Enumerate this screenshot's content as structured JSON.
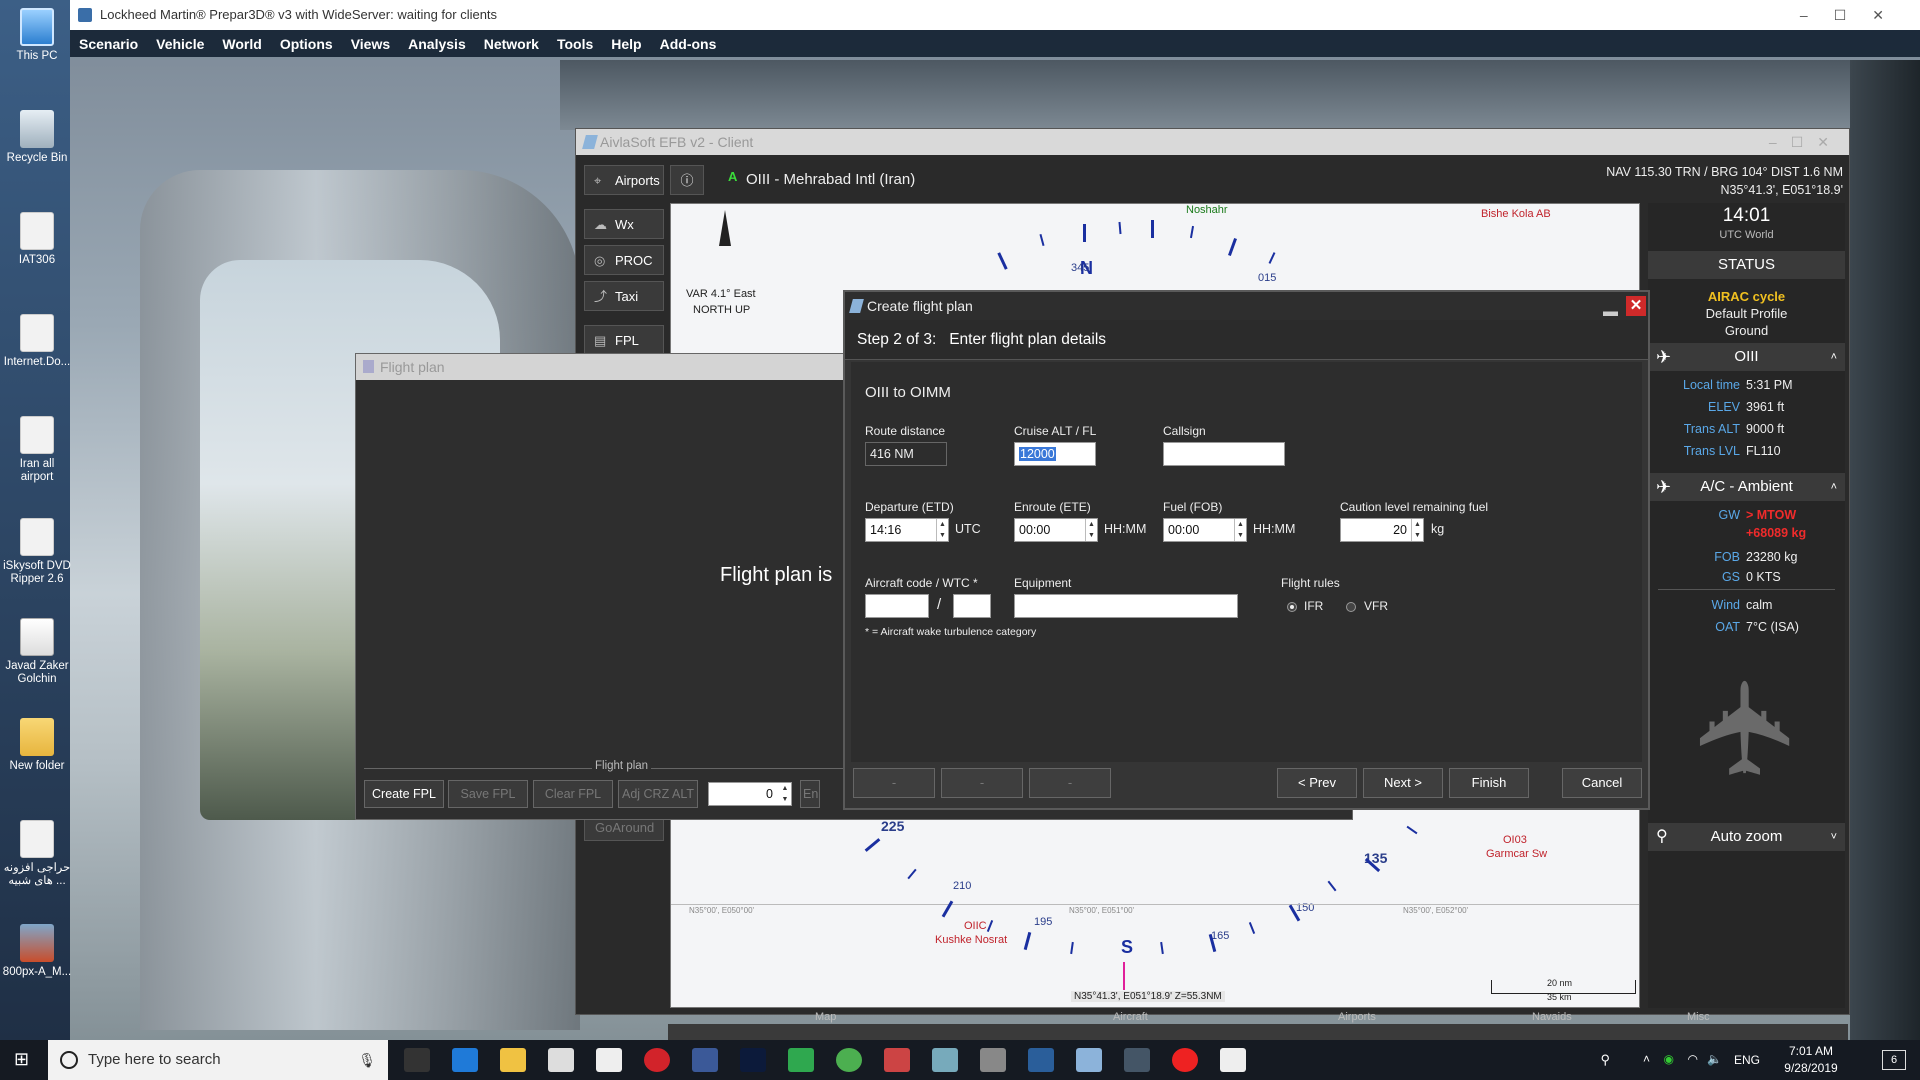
{
  "desktop": {
    "icons": [
      "This PC",
      "Recycle Bin",
      "IAT306",
      "Internet.Do...",
      "Iran all airport",
      "iSkysoft DVD Ripper 2.6",
      "Javad Zaker Golchin",
      "New folder",
      "حراجی افزونه های شبیه ...",
      "800px-A_M..."
    ]
  },
  "p3d": {
    "title": "Lockheed Martin® Prepar3D® v3 with WideServer: waiting for clients",
    "menu": [
      "Scenario",
      "Vehicle",
      "World",
      "Options",
      "Views",
      "Analysis",
      "Network",
      "Tools",
      "Help",
      "Add-ons"
    ]
  },
  "efb": {
    "title": "AivlaSoft EFB v2 - Client",
    "nav_buttons": [
      "Airports",
      "Wx",
      "PROC",
      "Taxi",
      "FPL",
      "GoAround"
    ],
    "airport_mark": "A",
    "airport_title": "OIII - Mehrabad Intl (Iran)",
    "nav_info_1": "NAV 115.30 TRN / BRG 104°  DIST 1.6 NM",
    "nav_info_2": "N35°41.3', E051°18.9'",
    "map": {
      "var_label": "VAR 4.1° East",
      "orientation": "NORTH UP",
      "labels": {
        "noshahr": "Noshahr",
        "bishe": "Bishe Kola AB",
        "n": "N",
        "s": "S",
        "h345": "345",
        "h015": "015",
        "h225": "225",
        "h210": "210",
        "h195": "195",
        "h165": "165",
        "h150": "150",
        "h135": "135",
        "oi03": "OI03",
        "garmcar": "Garmcar Sw",
        "oiic": "OIIC",
        "kushke": "Kushke Nosrat",
        "grid1": "N35°00', E050°00'",
        "grid2": "N35°00', E051°00'",
        "grid3": "N35°00', E052°00'",
        "cursor": "N35°41.3', E051°18.9'  Z=55.3NM",
        "scale_nm": "20 nm",
        "scale_km": "35 km"
      }
    },
    "status": {
      "time": "14:01",
      "time_label": "UTC World",
      "status_header": "STATUS",
      "airac": "AIRAC cycle",
      "profile": "Default Profile",
      "ground": "Ground",
      "airport_header": "OIII",
      "airport_rows": [
        {
          "k": "Local time",
          "v": "5:31 PM"
        },
        {
          "k": "ELEV",
          "v": "3961 ft"
        },
        {
          "k": "Trans ALT",
          "v": "9000 ft"
        },
        {
          "k": "Trans LVL",
          "v": "FL110"
        }
      ],
      "ac_header": "A/C - Ambient",
      "gw_label": "GW",
      "gw_value": "> MTOW",
      "gw_value2": "+68089 kg",
      "ac_rows": [
        {
          "k": "FOB",
          "v": "23280 kg"
        },
        {
          "k": "GS",
          "v": "0 KTS"
        },
        {
          "k": "Wind",
          "v": "calm"
        },
        {
          "k": "OAT",
          "v": "7°C (ISA)"
        }
      ],
      "autozoom": "Auto zoom"
    },
    "toolbar_groups": [
      "Map",
      "Aircraft",
      "Airports",
      "Navaids",
      "Misc"
    ]
  },
  "flight_plan_window": {
    "title": "Flight plan",
    "message": "Flight plan is",
    "group_label": "Flight plan",
    "buttons": [
      "Create FPL",
      "Save FPL",
      "Clear FPL",
      "Adj CRZ ALT"
    ],
    "counter": "0",
    "partial_btn": "En"
  },
  "create_fpl": {
    "title": "Create flight plan",
    "step": "Step 2 of 3:",
    "step_desc": "Enter flight plan details",
    "route": "OIII to OIMM",
    "route_distance_label": "Route distance",
    "route_distance": "416 NM",
    "cruise_label": "Cruise ALT / FL",
    "cruise": "12000",
    "callsign_label": "Callsign",
    "callsign": "",
    "departure_label": "Departure (ETD)",
    "departure": "14:16",
    "departure_unit": "UTC",
    "enroute_label": "Enroute (ETE)",
    "enroute": "00:00",
    "enroute_unit": "HH:MM",
    "fuel_label": "Fuel (FOB)",
    "fuel": "00:00",
    "fuel_unit": "HH:MM",
    "caution_label": "Caution level remaining fuel",
    "caution": "20",
    "caution_unit": "kg",
    "aircraft_label": "Aircraft code / WTC *",
    "slash": "/",
    "equipment_label": "Equipment",
    "rules_label": "Flight rules",
    "ifr": "IFR",
    "vfr": "VFR",
    "footnote": "* = Aircraft wake turbulence category",
    "blank_btns": [
      "-",
      "-",
      "-"
    ],
    "prev": "< Prev",
    "next": "Next >",
    "finish": "Finish",
    "cancel": "Cancel"
  },
  "taskbar": {
    "search_placeholder": "Type here to search",
    "lang": "ENG",
    "time": "7:01 AM",
    "date": "9/28/2019",
    "notif": "6"
  }
}
